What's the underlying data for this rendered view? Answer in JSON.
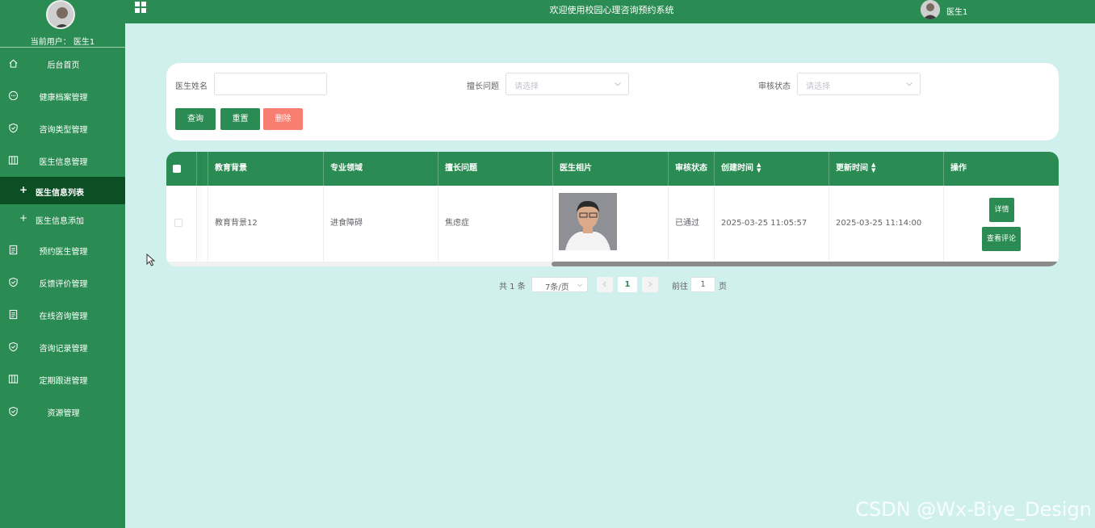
{
  "sidebar": {
    "current_user_label": "当前用户：  医生1",
    "menu": [
      {
        "label": "后台首页",
        "icon": "home-icon"
      },
      {
        "label": "健康档案管理",
        "icon": "chat-icon"
      },
      {
        "label": "咨询类型管理",
        "icon": "shield-icon"
      },
      {
        "label": "医生信息管理",
        "icon": "columns-icon"
      },
      {
        "label": "预约医生管理",
        "icon": "document-icon"
      },
      {
        "label": "反馈评价管理",
        "icon": "shield-icon"
      },
      {
        "label": "在线咨询管理",
        "icon": "document-icon"
      },
      {
        "label": "咨询记录管理",
        "icon": "shield-icon"
      },
      {
        "label": "定期跟进管理",
        "icon": "columns-icon"
      },
      {
        "label": "资源管理",
        "icon": "shield-icon"
      }
    ],
    "submenu": [
      {
        "label": "医生信息列表",
        "active": true
      },
      {
        "label": "医生信息添加",
        "active": false
      }
    ]
  },
  "topbar": {
    "title": "欢迎使用校园心理咨询预约系统",
    "username": "医生1"
  },
  "search": {
    "doctor_name_label": "医生姓名",
    "doctor_name_value": "",
    "specialty_label": "擅长问题",
    "specialty_placeholder": "请选择",
    "review_label": "审核状态",
    "review_placeholder": "请选择",
    "query_button": "查询",
    "reset_button": "重置",
    "delete_button": "删除"
  },
  "table": {
    "columns": [
      "教育背景",
      "专业领域",
      "擅长问题",
      "医生相片",
      "审核状态",
      "创建时间",
      "更新时间",
      "操作"
    ],
    "rows": [
      {
        "education": "教育背景12",
        "field": "进食障碍",
        "specialty": "焦虑症",
        "status": "已通过",
        "created": "2025-03-25 11:05:57",
        "updated": "2025-03-25 11:14:00",
        "detail_button": "详情",
        "review_button": "查看评论"
      }
    ]
  },
  "pagination": {
    "total": "共 1 条",
    "page_size": "7条/页",
    "current_page": "1",
    "goto_label": "前往",
    "goto_value": "1",
    "page_suffix": "页"
  },
  "watermark": "CSDN @Wx-Biye_Design",
  "colors": {
    "primary": "#2a8c52",
    "active_menu": "#0d4f25",
    "danger": "#f77e70",
    "background": "#d0f0ee"
  }
}
